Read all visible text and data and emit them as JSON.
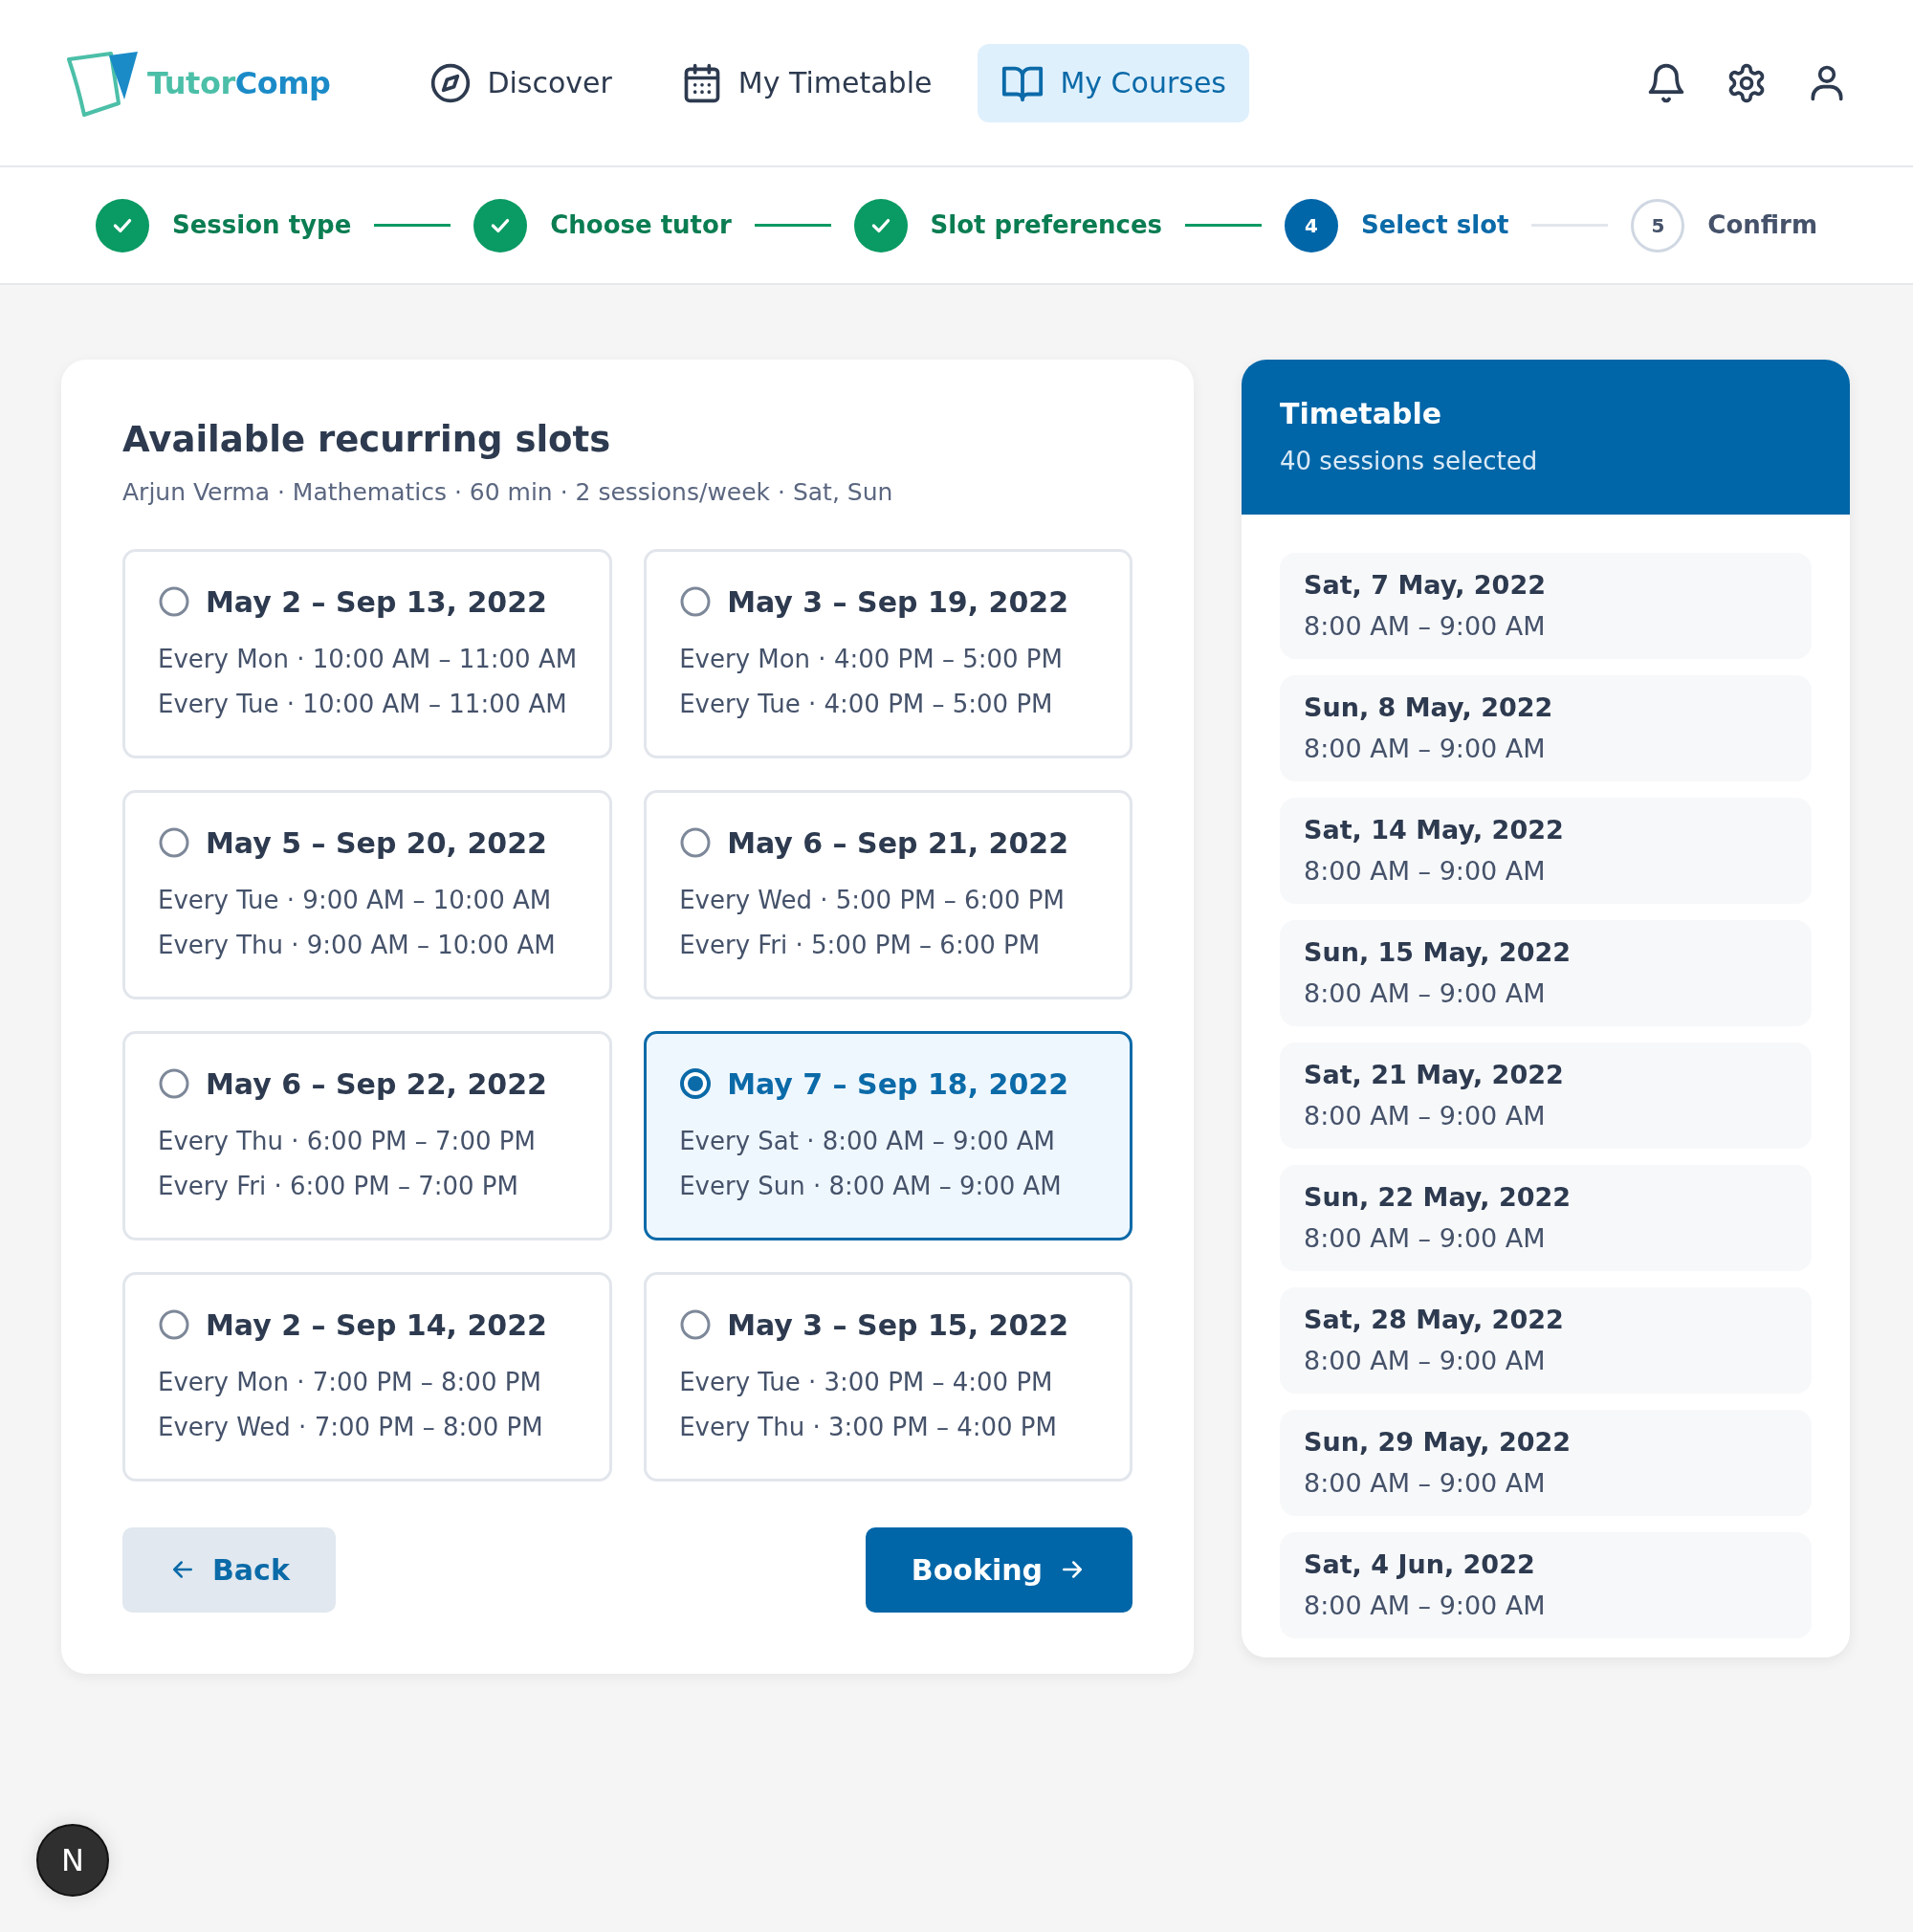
{
  "brand": [
    "Tutor",
    "Comp"
  ],
  "nav": [
    {
      "label": "Discover",
      "selected": false
    },
    {
      "label": "My Timetable",
      "selected": false
    },
    {
      "label": "My Courses",
      "selected": true
    }
  ],
  "steps": [
    {
      "label": "Session type",
      "completed": true
    },
    {
      "label": "Choose tutor",
      "completed": true
    },
    {
      "label": "Slot preferences",
      "completed": true
    },
    {
      "label": "Select slot",
      "number": "4",
      "completed": false,
      "current": true
    },
    {
      "label": "Confirm",
      "number": "5",
      "completed": false,
      "current": false
    }
  ],
  "panel": {
    "title": "Available recurring slots",
    "subtitle": "Arjun Verma · Mathematics · 60 min · 2 sessions/week · Sat, Sun"
  },
  "slots": [
    {
      "range": "May 2 – Sep 13, 2022",
      "lines": [
        "Every Mon · 10:00 AM – 11:00 AM",
        "Every Tue · 10:00 AM – 11:00 AM"
      ],
      "selected": false
    },
    {
      "range": "May 3 – Sep 19, 2022",
      "lines": [
        "Every Mon · 4:00 PM – 5:00 PM",
        "Every Tue · 4:00 PM – 5:00 PM"
      ],
      "selected": false
    },
    {
      "range": "May 5 – Sep 20, 2022",
      "lines": [
        "Every Tue · 9:00 AM – 10:00 AM",
        "Every Thu · 9:00 AM – 10:00 AM"
      ],
      "selected": false
    },
    {
      "range": "May 6 – Sep 21, 2022",
      "lines": [
        "Every Wed · 5:00 PM – 6:00 PM",
        "Every Fri · 5:00 PM – 6:00 PM"
      ],
      "selected": false
    },
    {
      "range": "May 6 – Sep 22, 2022",
      "lines": [
        "Every Thu · 6:00 PM – 7:00 PM",
        "Every Fri · 6:00 PM – 7:00 PM"
      ],
      "selected": false
    },
    {
      "range": "May 7 – Sep 18, 2022",
      "lines": [
        "Every Sat · 8:00 AM – 9:00 AM",
        "Every Sun · 8:00 AM – 9:00 AM"
      ],
      "selected": true
    },
    {
      "range": "May 2 – Sep 14, 2022",
      "lines": [
        "Every Mon · 7:00 PM – 8:00 PM",
        "Every Wed · 7:00 PM – 8:00 PM"
      ],
      "selected": false
    },
    {
      "range": "May 3 – Sep 15, 2022",
      "lines": [
        "Every Tue · 3:00 PM – 4:00 PM",
        "Every Thu · 3:00 PM – 4:00 PM"
      ],
      "selected": false
    }
  ],
  "buttons": {
    "back": "Back",
    "next": "Booking"
  },
  "timetable": {
    "title": "Timetable",
    "subtitle": "40 sessions selected",
    "sessions": [
      {
        "date": "Sat, 7 May, 2022",
        "time": "8:00 AM – 9:00 AM"
      },
      {
        "date": "Sun, 8 May, 2022",
        "time": "8:00 AM – 9:00 AM"
      },
      {
        "date": "Sat, 14 May, 2022",
        "time": "8:00 AM – 9:00 AM"
      },
      {
        "date": "Sun, 15 May, 2022",
        "time": "8:00 AM – 9:00 AM"
      },
      {
        "date": "Sat, 21 May, 2022",
        "time": "8:00 AM – 9:00 AM"
      },
      {
        "date": "Sun, 22 May, 2022",
        "time": "8:00 AM – 9:00 AM"
      },
      {
        "date": "Sat, 28 May, 2022",
        "time": "8:00 AM – 9:00 AM"
      },
      {
        "date": "Sun, 29 May, 2022",
        "time": "8:00 AM – 9:00 AM"
      },
      {
        "date": "Sat, 4 Jun, 2022",
        "time": "8:00 AM – 9:00 AM"
      }
    ]
  },
  "dev_badge": "N"
}
